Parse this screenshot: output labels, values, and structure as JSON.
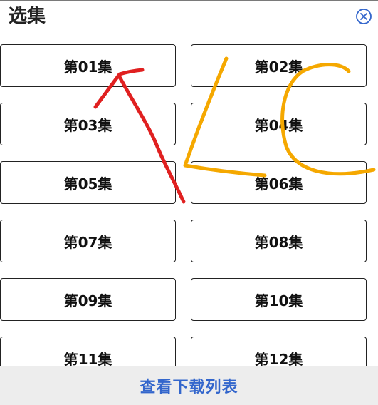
{
  "header": {
    "title": "选集",
    "close_icon": "close-circle-icon"
  },
  "episodes": [
    "第01集",
    "第02集",
    "第03集",
    "第04集",
    "第05集",
    "第06集",
    "第07集",
    "第08集",
    "第09集",
    "第10集",
    "第11集",
    "第12集"
  ],
  "footer": {
    "label": "查看下载列表"
  },
  "colors": {
    "accent": "#3366cc",
    "annotation_red": "#e02020",
    "annotation_orange": "#f5a800"
  }
}
